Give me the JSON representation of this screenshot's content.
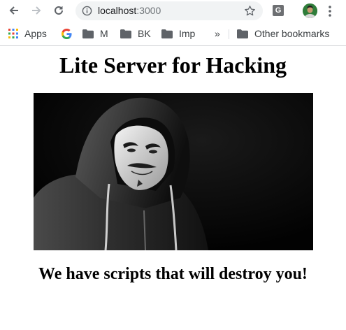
{
  "browser": {
    "address_bar": {
      "host": "localhost",
      "port": ":3000"
    },
    "extension_badge": "G",
    "bookmarks": [
      {
        "label": "Apps",
        "icon": "apps-grid-icon"
      },
      {
        "label": "",
        "icon": "google-logo-icon"
      },
      {
        "label": "M",
        "icon": "folder-icon"
      },
      {
        "label": "BK",
        "icon": "folder-icon"
      },
      {
        "label": "Imp",
        "icon": "folder-icon"
      }
    ],
    "overflow_label": "»",
    "other_bookmarks": "Other bookmarks"
  },
  "page": {
    "heading": "Lite Server for Hacking",
    "hero_image": "hooded-figure-mask-image",
    "tagline": "We have scripts that will destroy you!"
  },
  "colors": {
    "omnibox_bg": "#f1f3f4",
    "icon_gray": "#5f6368",
    "folder_gray": "#5f6368",
    "hero_bg": "#050505"
  }
}
